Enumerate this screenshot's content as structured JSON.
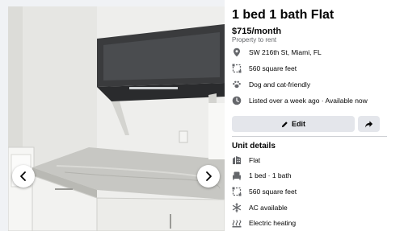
{
  "listing": {
    "title": "1 bed 1 bath Flat",
    "price": "$715/month",
    "subtype": "Property to rent",
    "details": [
      {
        "icon": "location-pin-icon",
        "text": "SW 216th St, Miami, FL"
      },
      {
        "icon": "area-icon",
        "text": "560 square feet"
      },
      {
        "icon": "paw-icon",
        "text": "Dog and cat-friendly"
      },
      {
        "icon": "clock-icon",
        "text": "Listed over a week ago · Available now"
      }
    ]
  },
  "actions": {
    "edit_label": "Edit",
    "edit_icon": "pencil-icon",
    "share_icon": "share-arrow-icon"
  },
  "unit_details": {
    "heading": "Unit details",
    "items": [
      {
        "icon": "building-icon",
        "text": "Flat"
      },
      {
        "icon": "bed-icon",
        "text": "1 bed · 1 bath"
      },
      {
        "icon": "area-icon",
        "text": "560 square feet"
      },
      {
        "icon": "snowflake-icon",
        "text": "AC available"
      },
      {
        "icon": "heat-icon",
        "text": "Electric heating"
      }
    ]
  },
  "photo_viewer": {
    "prev_icon": "chevron-left-icon",
    "next_icon": "chevron-right-icon"
  },
  "colors": {
    "panel_bg": "#ffffff",
    "button_bg": "#e4e6eb",
    "secondary_text": "#65676b",
    "icon_gray": "#65676b"
  }
}
